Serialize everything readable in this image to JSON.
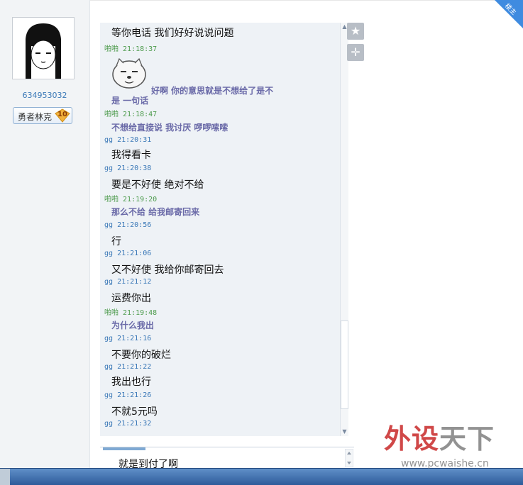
{
  "profile": {
    "user_id": "634953032",
    "rank_name": "勇者林克",
    "rank_level": "10"
  },
  "corner_badge": "楼主",
  "messages": [
    {
      "kind": "body",
      "text": "等你电话 我们好好说说问题"
    },
    {
      "kind": "head",
      "sender": "啪啪",
      "time": "21:18:37"
    },
    {
      "kind": "bold",
      "text": "好啊 你的意思就是不想给了是不"
    },
    {
      "kind": "bold",
      "text": "是 一句话"
    },
    {
      "kind": "head",
      "sender": "啪啪",
      "time": "21:18:47"
    },
    {
      "kind": "bold",
      "text": "不想给直接说 我讨厌 啰啰嗦嗦"
    },
    {
      "kind": "head",
      "sender": "gg",
      "time": "21:20:31"
    },
    {
      "kind": "body",
      "text": "我得看卡"
    },
    {
      "kind": "head",
      "sender": "gg",
      "time": "21:20:38"
    },
    {
      "kind": "body",
      "text": "要是不好使 绝对不给"
    },
    {
      "kind": "head",
      "sender": "啪啪",
      "time": "21:19:20"
    },
    {
      "kind": "bold",
      "text": "那么不给 给我邮寄回来"
    },
    {
      "kind": "head",
      "sender": "gg",
      "time": "21:20:56"
    },
    {
      "kind": "body",
      "text": "行"
    },
    {
      "kind": "head",
      "sender": "gg",
      "time": "21:21:06"
    },
    {
      "kind": "body",
      "text": "又不好使 我给你邮寄回去"
    },
    {
      "kind": "head",
      "sender": "gg",
      "time": "21:21:12"
    },
    {
      "kind": "body",
      "text": "运费你出"
    },
    {
      "kind": "head",
      "sender": "啪啪",
      "time": "21:19:48"
    },
    {
      "kind": "bold",
      "text": "为什么我出"
    },
    {
      "kind": "head",
      "sender": "gg",
      "time": "21:21:16"
    },
    {
      "kind": "body",
      "text": "不要你的破烂"
    },
    {
      "kind": "head",
      "sender": "gg",
      "time": "21:21:22"
    },
    {
      "kind": "body",
      "text": "我出也行"
    },
    {
      "kind": "head",
      "sender": "gg",
      "time": "21:21:26"
    },
    {
      "kind": "body",
      "text": "不就5元吗"
    },
    {
      "kind": "head",
      "sender": "gg",
      "time": "21:21:32"
    }
  ],
  "input": {
    "text": "就是到付了啊"
  },
  "watermark": {
    "main_red": "外设",
    "main_gray": "天下",
    "url": "www.pcwaishe.cn"
  },
  "colors": {
    "sender_green": "#4d9b4d",
    "sender_blue": "#3a78b7",
    "bold_text": "#6a6aa8"
  }
}
